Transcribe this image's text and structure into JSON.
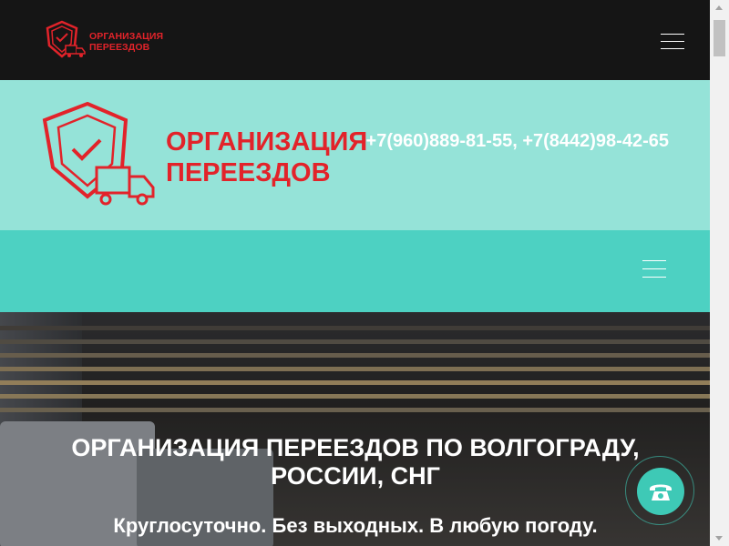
{
  "topbar": {
    "logo_line1": "ОРГАНИЗАЦИЯ",
    "logo_line2": "ПЕРЕЕЗДОВ",
    "menu_icon": "hamburger-icon"
  },
  "header": {
    "logo_line1": "ОРГАНИЗАЦИЯ",
    "logo_line2": "ПЕРЕЕЗДОВ",
    "logo_icon": "shield-truck-icon",
    "phones": "+7(960)889-81-55, +7(8442)98-42-65"
  },
  "nav": {
    "menu_icon": "hamburger-icon"
  },
  "hero": {
    "title": "ОРГАНИЗАЦИЯ ПЕРЕЕЗДОВ ПО ВОЛГОГРАДУ, РОССИИ, СНГ",
    "subtitle": "Круглосуточно. Без выходных. В любую погоду."
  },
  "call_button": {
    "icon": "phone-icon"
  },
  "colors": {
    "brand_red": "#e2232a",
    "header_bg": "#95e3d8",
    "nav_bg": "#4dd1c2",
    "topbar_bg": "#151515",
    "call_bg": "#3ec9b6"
  }
}
